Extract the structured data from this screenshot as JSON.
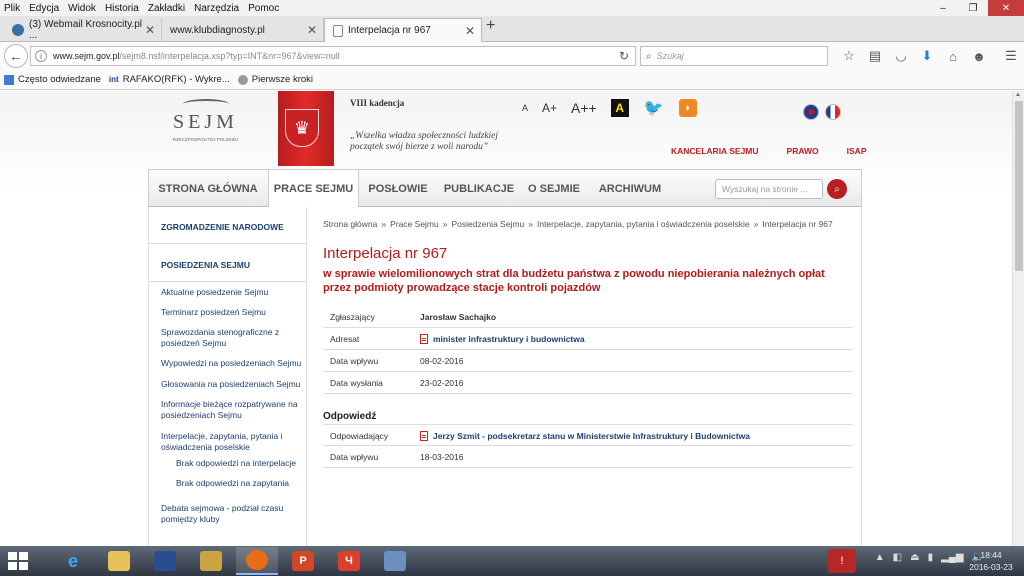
{
  "menu": [
    "Plik",
    "Edycja",
    "Widok",
    "Historia",
    "Zakładki",
    "Narzędzia",
    "Pomoc"
  ],
  "window_controls": {
    "minimize": "–",
    "maximize": "❐",
    "close": "✕"
  },
  "tabs": [
    {
      "title": "(3) Webmail Krosnocity.pl ...",
      "close": "✕"
    },
    {
      "title": "www.klubdiagnosty.pl",
      "close": "✕"
    },
    {
      "title": "Interpelacja nr 967",
      "close": "✕"
    }
  ],
  "new_tab": "+",
  "url": {
    "host": "www.sejm.gov.pl",
    "path": "/sejm8.nsf/interpelacja.xsp?typ=INT&nr=967&view=null"
  },
  "browser_search": {
    "placeholder": "Szukaj"
  },
  "bookmarks": [
    "Często odwiedzane",
    "RAFAKO(RFK) - Wykre...",
    "Pierwsze kroki"
  ],
  "bookmark_logo": "int",
  "site": {
    "logo_word": "SEJM",
    "logo_sub": "RZECZPOSPOLITEJ POLSKIEJ",
    "kadencja": "VIII kadencja",
    "quote": "„Wszelka władza społeczności ludzkiej początek swój bierze z woli narodu”",
    "font_sizes": [
      "A",
      "A+",
      "A++"
    ],
    "contrast": "A",
    "top_links": [
      "KANCELARIA SEJMU",
      "PRAWO",
      "ISAP"
    ],
    "nav": [
      "STRONA GŁÓWNA",
      "PRACE SEJMU",
      "POSŁOWIE",
      "PUBLIKACJE",
      "O SEJMIE",
      "ARCHIWUM"
    ],
    "nav_active": "PRACE SEJMU",
    "search_placeholder": "Wyszukaj na stronie ..."
  },
  "sidebar": {
    "head1": "ZGROMADZENIE NARODOWE",
    "head2": "POSIEDZENIA SEJMU",
    "links": [
      "Aktualne posiedzenie Sejmu",
      "Terminarz posiedzeń Sejmu",
      "Sprawozdania stenograficzne z posiedzeń Sejmu",
      "Wypowiedzi na posiedzeniach Sejmu",
      "Głosowania na posiedzeniach Sejmu",
      "Informacje bieżące rozpatrywane na posiedzeniach Sejmu",
      "Interpelacje, zapytania, pytania i oświadczenia poselskie",
      "Brak odpowiedzi na interpelacje",
      "Brak odpowiedzi na zapytania",
      "Debata sejmowa - podział czasu pomiędzy kluby"
    ]
  },
  "breadcrumb": [
    "Strona główna",
    "Prace Sejmu",
    "Posiedzenia Sejmu",
    "Interpelacje, zapytania, pytania i oświadczenia poselskie",
    "Interpelacja nr 967"
  ],
  "breadcrumb_sep": "»",
  "interpelacja": {
    "title": "Interpelacja nr 967",
    "subject": "w sprawie wielomilionowych strat dla budżetu państwa z powodu niepobierania należnych opłat przez podmioty prowadzące stacje kontroli pojazdów",
    "fields": [
      {
        "label": "Zgłaszający",
        "value": "Jarosław Sachajko"
      },
      {
        "label": "Adresat",
        "value": "minister infrastruktury i budownictwa"
      },
      {
        "label": "Data wpływu",
        "value": "08-02-2016"
      },
      {
        "label": "Data wysłania",
        "value": "23-02-2016"
      }
    ],
    "answer_heading": "Odpowiedź",
    "answer_fields": [
      {
        "label": "Odpowiadający",
        "value": "Jerzy Szmit - podsekretarz stanu w Ministerstwie Infrastruktury i Budownictwa"
      },
      {
        "label": "Data wpływu",
        "value": "18-03-2016"
      }
    ]
  },
  "clock": {
    "time": "18:44",
    "date": "2016-03-23"
  }
}
